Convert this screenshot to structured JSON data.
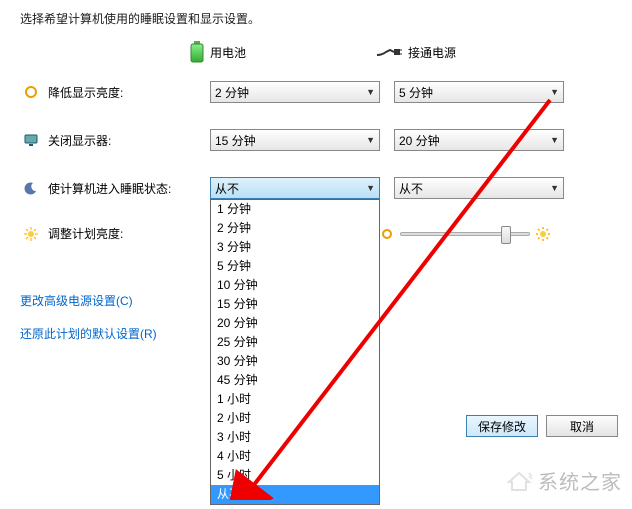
{
  "header": "选择希望计算机使用的睡眠设置和显示设置。",
  "columns": {
    "battery": "用电池",
    "plugged": "接通电源"
  },
  "rows": {
    "dim": {
      "label": "降低显示亮度:",
      "battery_value": "2 分钟",
      "plugged_value": "5 分钟"
    },
    "display_off": {
      "label": "关闭显示器:",
      "battery_value": "15 分钟",
      "plugged_value": "20 分钟"
    },
    "sleep": {
      "label": "使计算机进入睡眠状态:",
      "battery_value": "从不",
      "plugged_value": "从不"
    },
    "brightness": {
      "label": "调整计划亮度:"
    }
  },
  "dropdown_options": [
    "1 分钟",
    "2 分钟",
    "3 分钟",
    "5 分钟",
    "10 分钟",
    "15 分钟",
    "20 分钟",
    "25 分钟",
    "30 分钟",
    "45 分钟",
    "1 小时",
    "2 小时",
    "3 小时",
    "4 小时",
    "5 小时",
    "从不"
  ],
  "dropdown_highlight_index": 15,
  "links": {
    "advanced": "更改高级电源设置(C)",
    "restore": "还原此计划的默认设置(R)"
  },
  "buttons": {
    "save": "保存修改",
    "cancel": "取消"
  },
  "watermark": "系统之家",
  "colors": {
    "link": "#0066cc",
    "highlight": "#3399ff"
  }
}
